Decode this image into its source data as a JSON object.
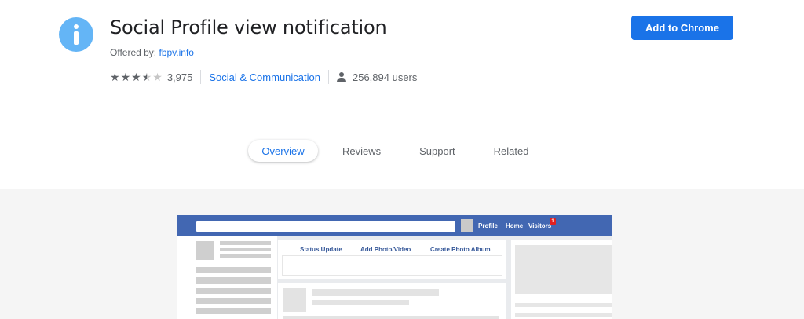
{
  "extension": {
    "title": "Social Profile view notification",
    "offered_by_label": "Offered by:",
    "offered_by_link": "fbpv.info",
    "rating": 3.5,
    "rating_count": "3,975",
    "category": "Social & Communication",
    "users": "256,894 users",
    "icon": "info-icon",
    "accent_color": "#1a73e8",
    "icon_color": "#64b5f6"
  },
  "actions": {
    "add_label": "Add to Chrome"
  },
  "tabs": [
    {
      "label": "Overview",
      "active": true
    },
    {
      "label": "Reviews",
      "active": false
    },
    {
      "label": "Support",
      "active": false
    },
    {
      "label": "Related",
      "active": false
    }
  ],
  "preview": {
    "nav_links": [
      "Profile",
      "Home",
      "Visitors"
    ],
    "visitors_badge": "1",
    "composer_actions": [
      "Status Update",
      "Add Photo/Video",
      "Create Photo Album"
    ],
    "nav_color": "#4267b2"
  }
}
